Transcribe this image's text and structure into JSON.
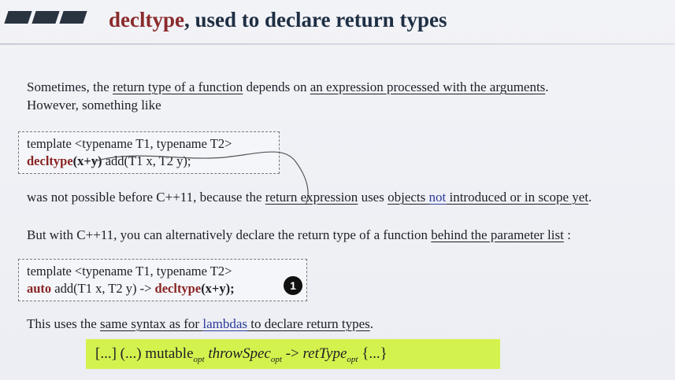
{
  "title": {
    "keyword": "decltype",
    "rest": ", used to declare return types"
  },
  "para1": {
    "a": "Sometimes, the ",
    "b": "return type of a function",
    "c": " depends on ",
    "d": "an expression processed with the arguments",
    "e": ".",
    "line2": "However, something like"
  },
  "code1": {
    "line1": "template <typename T1, typename T2>",
    "kw": "decltype",
    "args": "(x+y)",
    "rest": " add(T1 x, T2 y);"
  },
  "para2": {
    "a": "was not possible before C++11, because the ",
    "b": "return expression",
    "c": " uses ",
    "d": "objects ",
    "e": "not",
    "f": " introduced or in scope yet",
    "g": "."
  },
  "para3": {
    "a": "But with C++11, you can alternatively declare the return type of a function ",
    "b": "behind the parameter list",
    "c": " :"
  },
  "code2": {
    "line1": "template <typename T1, typename T2>",
    "auto": "auto",
    "mid": " add(T1 x, T2 y) -> ",
    "kw": "decltype",
    "args": "(x+y);",
    "marker": "1"
  },
  "para4": {
    "a": "This uses the ",
    "b": "same syntax as for ",
    "c": "lambdas",
    "d": " to declare return types",
    "e": "."
  },
  "syntax": {
    "a": "[...] (...) mutable",
    "opt1": "opt",
    "b": "throwSpec",
    "opt2": "opt",
    "arrow": " -> ",
    "c": "retType",
    "opt3": "opt",
    "d": " {...}"
  }
}
